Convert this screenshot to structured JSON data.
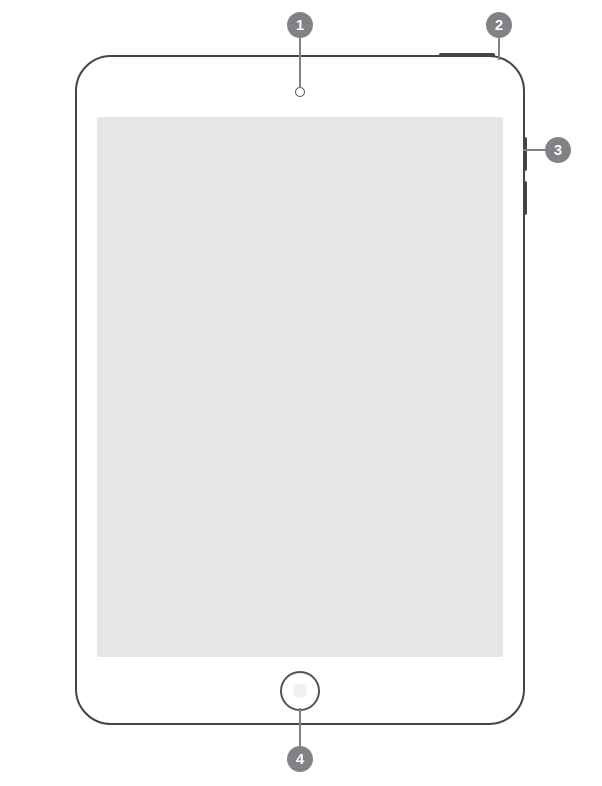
{
  "device": {
    "name": "tablet-front-view"
  },
  "callouts": [
    {
      "id": "1",
      "label": "1",
      "target": "front-camera"
    },
    {
      "id": "2",
      "label": "2",
      "target": "top-button"
    },
    {
      "id": "3",
      "label": "3",
      "target": "volume-buttons"
    },
    {
      "id": "4",
      "label": "4",
      "target": "home-button"
    }
  ],
  "colors": {
    "badge_bg": "#808285",
    "badge_text": "#ffffff",
    "device_outline": "#444444",
    "screen_fill": "#e6e6e6"
  }
}
